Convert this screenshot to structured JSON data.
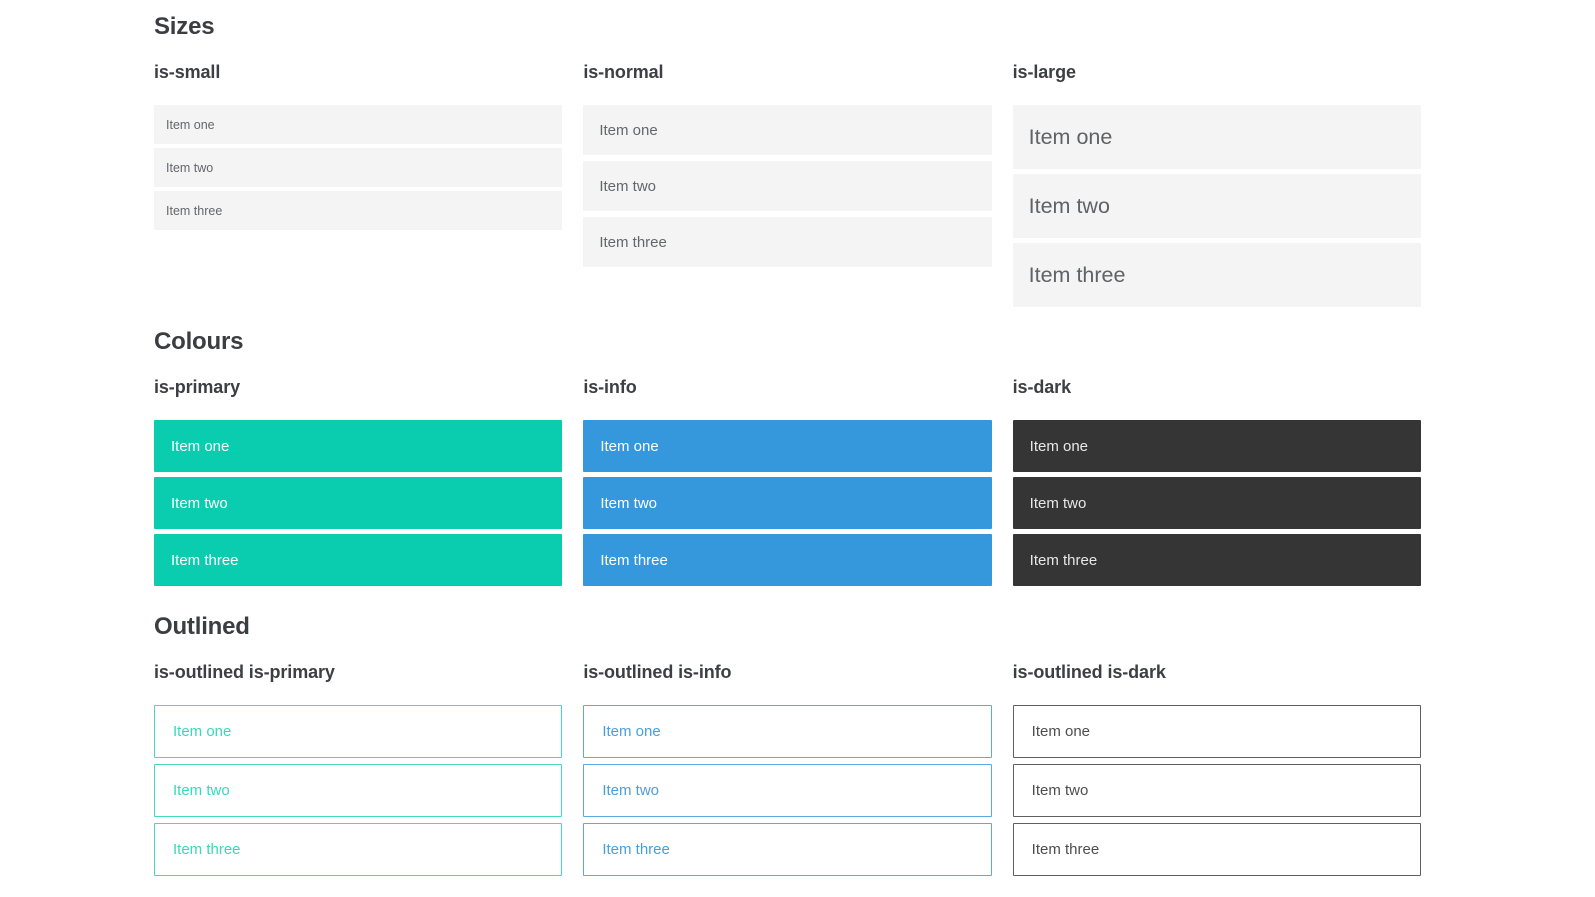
{
  "colors": {
    "primary": "#0accaf",
    "info": "#3598dc",
    "dark": "#353535",
    "item_background_grey": "#f4f4f4",
    "item_text_grey": "#63666b",
    "heading_text": "#3a3d41"
  },
  "sections": [
    {
      "title": "Sizes",
      "groups": [
        {
          "label": "is-small",
          "items": [
            "Item one",
            "Item two",
            "Item three"
          ]
        },
        {
          "label": "is-normal",
          "items": [
            "Item one",
            "Item two",
            "Item three"
          ]
        },
        {
          "label": "is-large",
          "items": [
            "Item one",
            "Item two",
            "Item three"
          ]
        }
      ]
    },
    {
      "title": "Colours",
      "groups": [
        {
          "label": "is-primary",
          "items": [
            "Item one",
            "Item two",
            "Item three"
          ]
        },
        {
          "label": "is-info",
          "items": [
            "Item one",
            "Item two",
            "Item three"
          ]
        },
        {
          "label": "is-dark",
          "items": [
            "Item one",
            "Item two",
            "Item three"
          ]
        }
      ]
    },
    {
      "title": "Outlined",
      "groups": [
        {
          "label": "is-outlined is-primary",
          "items": [
            "Item one",
            "Item two",
            "Item three"
          ]
        },
        {
          "label": "is-outlined is-info",
          "items": [
            "Item one",
            "Item two",
            "Item three"
          ]
        },
        {
          "label": "is-outlined is-dark",
          "items": [
            "Item one",
            "Item two",
            "Item three"
          ]
        }
      ]
    }
  ]
}
